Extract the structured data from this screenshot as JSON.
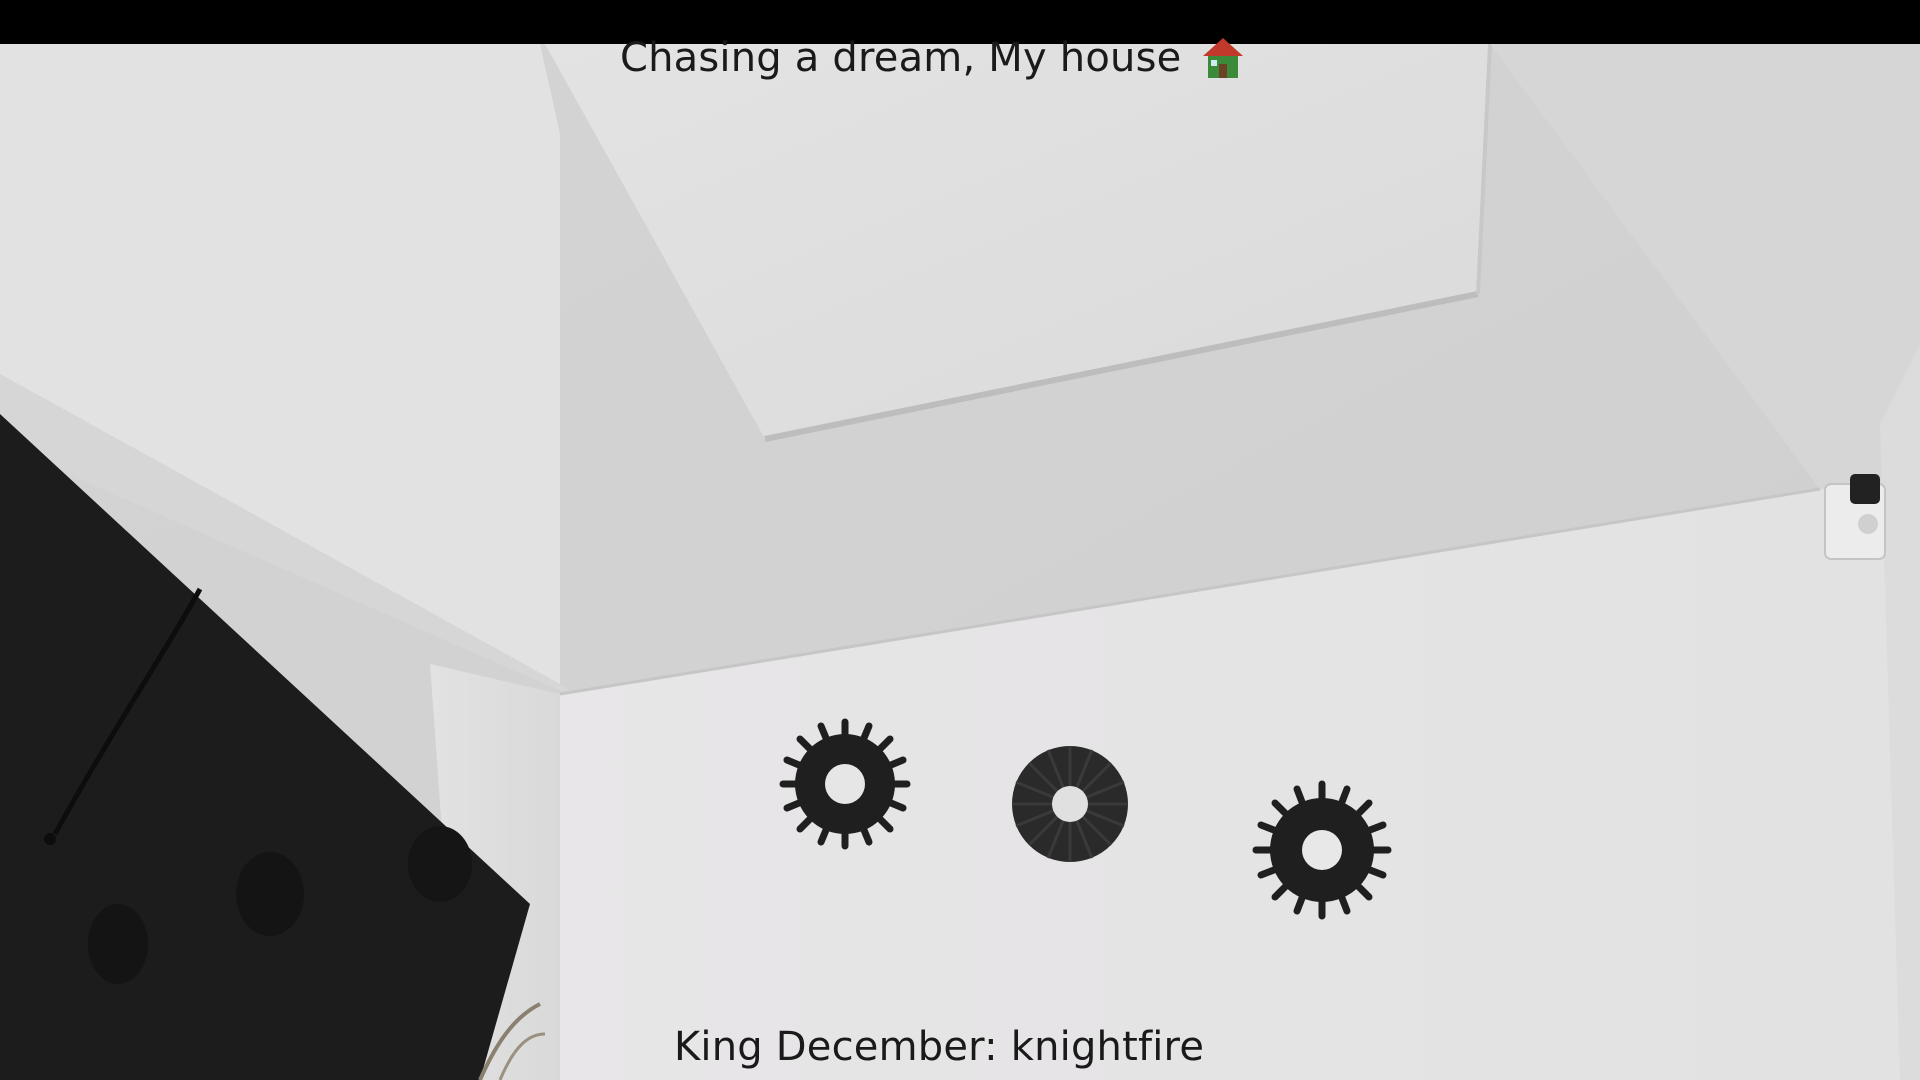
{
  "stream": {
    "title": "Chasing a dream, My house",
    "title_icon": "house-icon",
    "chat_message": "King December: knightfire"
  },
  "colors": {
    "ceiling": "#d9d9d9",
    "wall": "#e6e5e6",
    "dark_panel": "#1c1c1c",
    "text": "#1a1a1a",
    "house_roof": "#c0392b",
    "house_body": "#3a8a3a"
  }
}
